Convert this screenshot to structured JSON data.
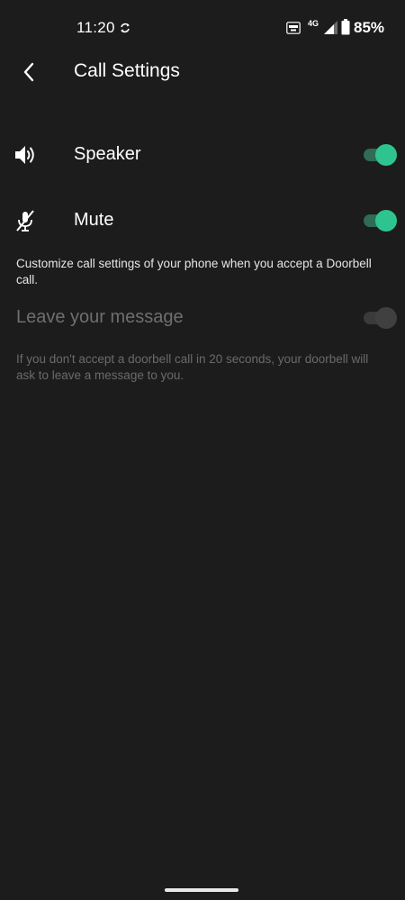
{
  "status_bar": {
    "time": "11:20",
    "network": "4G",
    "battery": "85%",
    "icons": [
      "sync-icon",
      "auto-icon",
      "signal-icon",
      "battery-icon"
    ]
  },
  "header": {
    "title": "Call Settings",
    "back_icon": "chevron-left-icon"
  },
  "settings": {
    "speaker": {
      "label": "Speaker",
      "icon": "speaker-icon",
      "enabled": true
    },
    "mute": {
      "label": "Mute",
      "icon": "mic-off-icon",
      "enabled": true
    },
    "call_description": "Customize call settings of your phone when you accept a Doorbell call.",
    "leave_message": {
      "label": "Leave your message",
      "enabled": false,
      "disabled": true
    },
    "leave_message_description": "If you don't accept a doorbell call in 20 seconds, your doorbell will ask to leave a message to you."
  },
  "colors": {
    "background": "#1c1c1c",
    "toggle_on": "#2ec48f",
    "toggle_track_on": "#2f6b55",
    "text_disabled": "#6f6f6f"
  }
}
